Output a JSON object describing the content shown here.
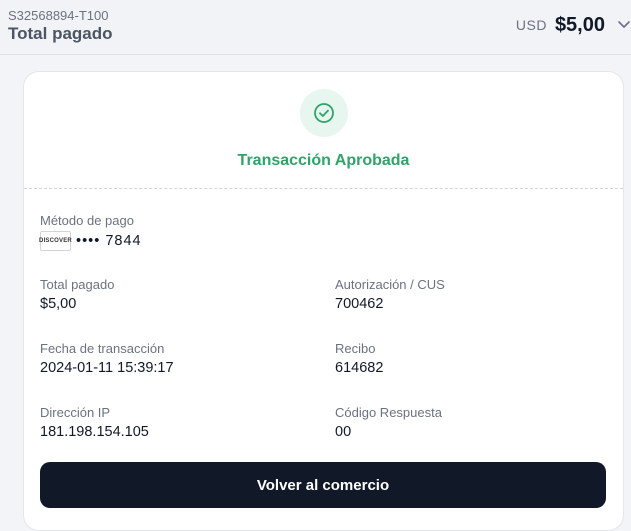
{
  "header": {
    "reference": "S32568894-T100",
    "title": "Total pagado",
    "currency": "USD",
    "amount": "$5,00",
    "expand_icon": "chevron-down-icon"
  },
  "status": {
    "icon": "check-circle-icon",
    "title": "Transacción Aprobada",
    "color": "#2fa46a"
  },
  "details": {
    "payment_method": {
      "label": "Método de pago",
      "card_brand": "DISCOVER",
      "masked": "•••• 7844"
    },
    "total_paid": {
      "label": "Total pagado",
      "value": "$5,00"
    },
    "authorization": {
      "label": "Autorización / CUS",
      "value": "700462"
    },
    "transaction_date": {
      "label": "Fecha de transacción",
      "value": "2024-01-11 15:39:17"
    },
    "receipt": {
      "label": "Recibo",
      "value": "614682"
    },
    "ip_address": {
      "label": "Dirección IP",
      "value": "181.198.154.105"
    },
    "response_code": {
      "label": "Código Respuesta",
      "value": "00"
    }
  },
  "actions": {
    "back_label": "Volver al comercio"
  }
}
